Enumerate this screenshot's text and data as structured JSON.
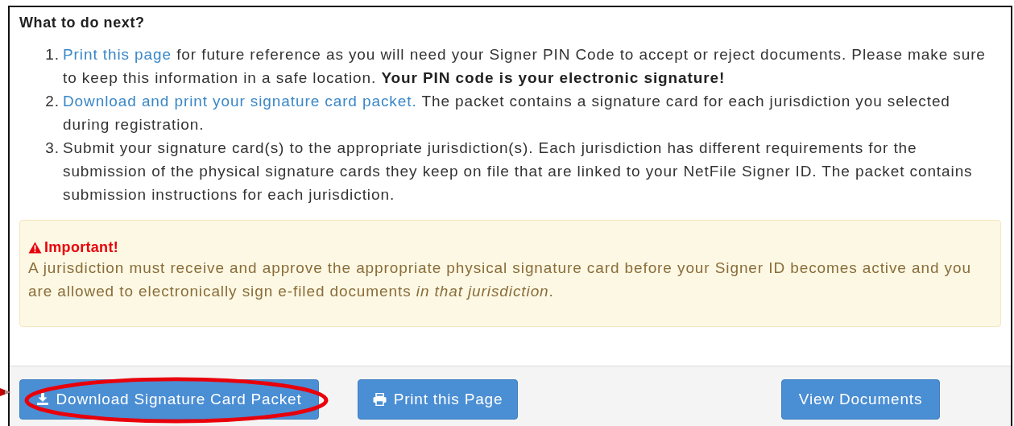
{
  "heading": "What to do next?",
  "steps": [
    {
      "number": "1.",
      "link": "Print this page",
      "text": " for future reference as you will need your Signer PIN Code to accept or reject documents. Please make sure to keep this information in a safe location. **Your PIN code is your electronic signature!**"
    },
    {
      "number": "2.",
      "link": "Download and print your signature card packet.",
      "text": " The packet contains a signature card for each jurisdiction you selected during registration."
    },
    {
      "number": "3.",
      "text": "Submit your signature card(s) to the appropriate jurisdiction(s). Each jurisdiction has different requirements for the submission of the physical signature cards they keep on file that are linked to your NetFile Signer ID. The packet contains submission instructions for each jurisdiction."
    }
  ],
  "alert": {
    "title": "Important!",
    "text": "A jurisdiction must receive and approve the appropriate physical signature card before your Signer ID becomes active and you are allowed to electronically sign e-filed documents *in that jurisdiction*."
  },
  "buttons": [
    {
      "label": "Download Signature Card Packet",
      "highlighted": true
    },
    {
      "label": "Print this Page",
      "highlighted": false
    },
    {
      "label": "View Documents",
      "highlighted": false
    }
  ]
}
